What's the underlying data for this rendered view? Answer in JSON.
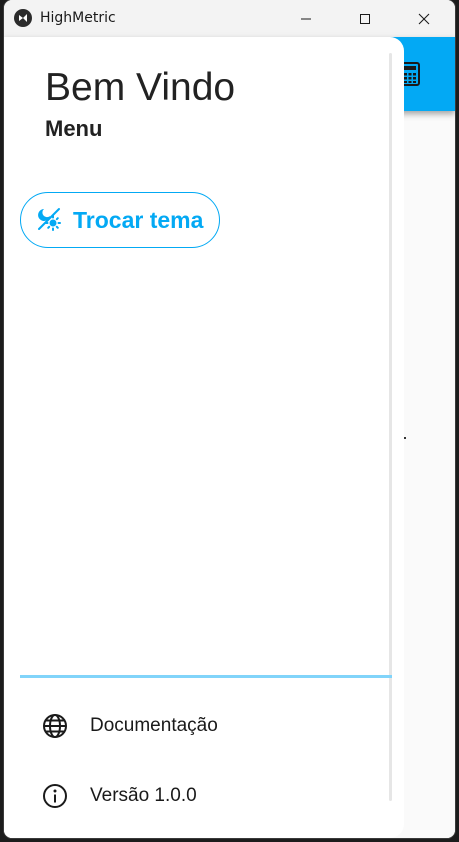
{
  "window": {
    "title": "HighMetric",
    "icon": "kivy-icon",
    "controls": [
      "minimize-icon",
      "maximize-icon",
      "close-icon"
    ]
  },
  "appbar": {
    "action_icon": "calculator-icon",
    "color": "#03a9f4"
  },
  "drawer": {
    "title": "Bem Vindo",
    "subtitle": "Menu",
    "theme_button": {
      "label": "Trocar tema",
      "icon": "theme-light-dark-icon"
    },
    "items": [
      {
        "label": "Documentação",
        "icon": "globe-icon"
      },
      {
        "label": "Versão 1.0.0",
        "icon": "info-icon"
      }
    ]
  },
  "colors": {
    "accent": "#03a9f4",
    "divider": "#81d4fa",
    "text": "#1a1a1a"
  }
}
